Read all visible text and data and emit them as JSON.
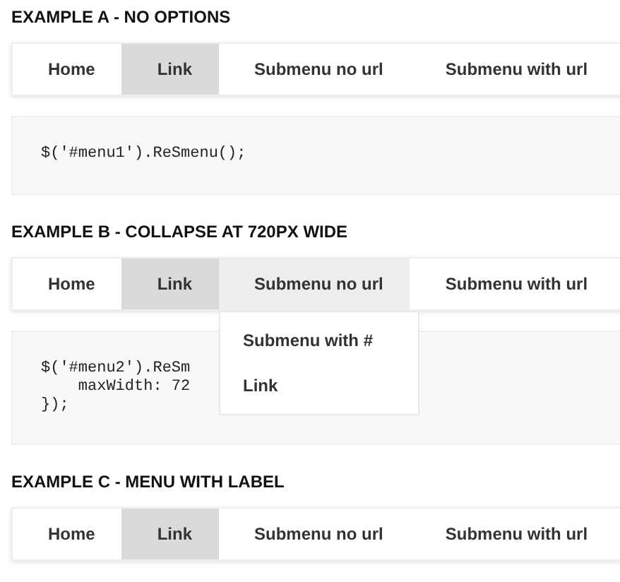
{
  "examples": [
    {
      "heading": "EXAMPLE A - NO OPTIONS",
      "menu": [
        {
          "label": "Home",
          "selected": false,
          "expanded": false
        },
        {
          "label": "Link",
          "selected": true,
          "expanded": false
        },
        {
          "label": "Submenu no url",
          "selected": false,
          "expanded": false
        },
        {
          "label": "Submenu with url",
          "selected": false,
          "expanded": false
        }
      ],
      "code": [
        "$('#menu1').ReSmenu();"
      ]
    },
    {
      "heading": "EXAMPLE B - COLLAPSE AT 720PX WIDE",
      "menu": [
        {
          "label": "Home",
          "selected": false,
          "expanded": false
        },
        {
          "label": "Link",
          "selected": true,
          "expanded": false
        },
        {
          "label": "Submenu no url",
          "selected": false,
          "expanded": true,
          "children": [
            "Submenu with #",
            "Link"
          ]
        },
        {
          "label": "Submenu with url",
          "selected": false,
          "expanded": false
        }
      ],
      "code": [
        "$('#menu2').ReSm",
        "    maxWidth: 72",
        "});"
      ]
    },
    {
      "heading": "EXAMPLE C - MENU WITH LABEL",
      "menu": [
        {
          "label": "Home",
          "selected": false,
          "expanded": false
        },
        {
          "label": "Link",
          "selected": true,
          "expanded": false
        },
        {
          "label": "Submenu no url",
          "selected": false,
          "expanded": false
        },
        {
          "label": "Submenu with url",
          "selected": false,
          "expanded": false
        }
      ]
    }
  ]
}
